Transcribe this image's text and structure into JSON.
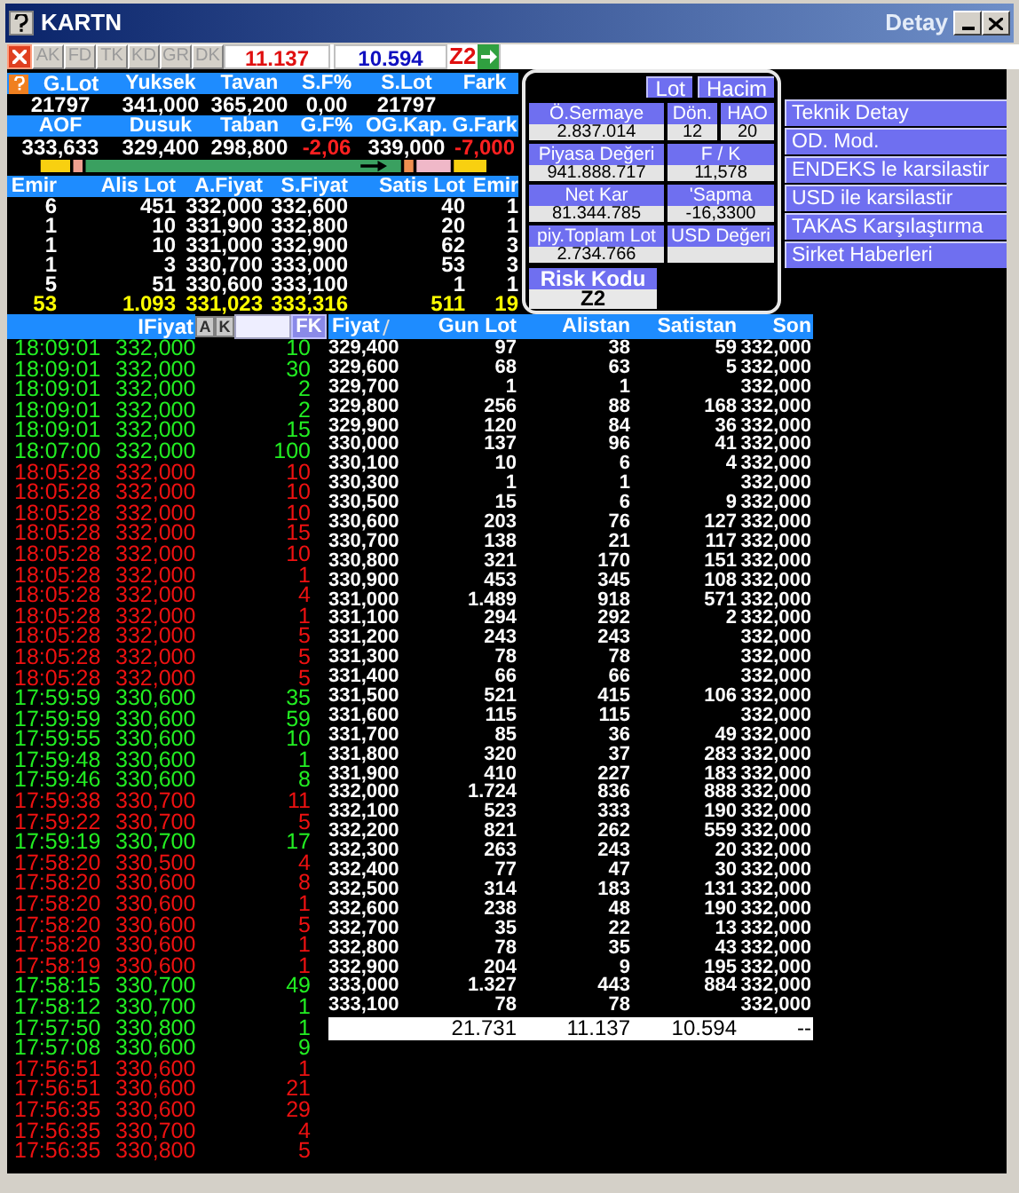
{
  "window": {
    "title": "KARTN",
    "detail_title": "Detay"
  },
  "toolbar": {
    "tabs": [
      {
        "label": "AK",
        "disabled": true
      },
      {
        "label": "FD",
        "disabled": true
      },
      {
        "label": "TK",
        "disabled": true
      },
      {
        "label": "KD",
        "disabled": true
      },
      {
        "label": "GR",
        "disabled": true
      },
      {
        "label": "DK",
        "disabled": true
      }
    ],
    "buy_total": "11.137",
    "sell_total": "10.594",
    "risk_code": "Z2"
  },
  "summary": [
    {
      "kind": "header",
      "cells": [
        {
          "text": "G.Lot"
        },
        {
          "text": "Yuksek"
        },
        {
          "text": "Tavan"
        },
        {
          "text": "S.F%"
        },
        {
          "text": "S.Lot"
        },
        {
          "text": "Fark"
        }
      ]
    },
    {
      "kind": "values",
      "cells": [
        {
          "text": "21797"
        },
        {
          "text": "341,000"
        },
        {
          "text": "365,200"
        },
        {
          "text": "0,00"
        },
        {
          "text": "21797"
        }
      ]
    },
    {
      "kind": "header",
      "cells": [
        {
          "text": "AOF"
        },
        {
          "text": "Dusuk"
        },
        {
          "text": "Taban"
        },
        {
          "text": "G.F%"
        },
        {
          "text": "OG.Kap."
        },
        {
          "text": "G.Fark"
        }
      ]
    },
    {
      "kind": "values",
      "cells": [
        {
          "text": "333,633"
        },
        {
          "text": "329,400"
        },
        {
          "text": "298,800"
        },
        {
          "text": "-2,06",
          "color": "#ff2020"
        },
        {
          "text": "339,000"
        },
        {
          "text": "-7,000",
          "color": "#ff2020"
        }
      ]
    }
  ],
  "depth": {
    "columns": [
      "Emir",
      "Alis Lot",
      "A.Fiyat",
      "S.Fiyat",
      "Satis Lot",
      "Emir"
    ],
    "rows": [
      [
        "6",
        "451",
        "332,000",
        "332,600",
        "40",
        "1"
      ],
      [
        "1",
        "10",
        "331,900",
        "332,800",
        "20",
        "1"
      ],
      [
        "1",
        "10",
        "331,000",
        "332,900",
        "62",
        "3"
      ],
      [
        "1",
        "3",
        "330,700",
        "333,000",
        "53",
        "3"
      ],
      [
        "5",
        "51",
        "330,600",
        "333,100",
        "1",
        "1"
      ]
    ],
    "total": [
      "53",
      "1.093",
      "331,023",
      "333,316",
      "511",
      "19"
    ]
  },
  "fundamentals": {
    "buttons": [
      {
        "label": "Lot"
      },
      {
        "label": "Hacim"
      }
    ],
    "fields": [
      {
        "label": "Ö.Sermaye",
        "value": "2.837.014"
      },
      {
        "label": "Dön.",
        "value": "12"
      },
      {
        "label": "HAO",
        "value": "20"
      },
      {
        "label": "Piyasa Değeri",
        "value": "941.888.717"
      },
      {
        "label": "F / K",
        "value": "11,578"
      },
      {
        "label": "Net Kar",
        "value": "81.344.785"
      },
      {
        "label": "'Sapma",
        "value": "-16,3300"
      },
      {
        "label": "piy.Toplam Lot",
        "value": "2.734.766"
      },
      {
        "label": "USD Değeri"
      }
    ],
    "risk": {
      "label": "Risk Kodu",
      "value": "Z2"
    }
  },
  "menu": [
    {
      "label": "Teknik Detay"
    },
    {
      "label": "OD. Mod."
    },
    {
      "label": "ENDEKS le karsilastir"
    },
    {
      "label": "USD ile karsilastir"
    },
    {
      "label": "TAKAS Karşılaştırma"
    },
    {
      "label": "Sirket Haberleri"
    }
  ],
  "trades": {
    "header": "IFiyat",
    "buttons": [
      "A",
      "K"
    ],
    "filter_button": "FK",
    "rows": [
      {
        "time": "18:09:01",
        "price": "332,000",
        "lot": "10",
        "color": "#22ee22"
      },
      {
        "time": "18:09:01",
        "price": "332,000",
        "lot": "30",
        "color": "#22ee22"
      },
      {
        "time": "18:09:01",
        "price": "332,000",
        "lot": "2",
        "color": "#22ee22"
      },
      {
        "time": "18:09:01",
        "price": "332,000",
        "lot": "2",
        "color": "#22ee22"
      },
      {
        "time": "18:09:01",
        "price": "332,000",
        "lot": "15",
        "color": "#22ee22"
      },
      {
        "time": "18:07:00",
        "price": "332,000",
        "lot": "100",
        "color": "#22ee22"
      },
      {
        "time": "18:05:28",
        "price": "332,000",
        "lot": "10",
        "color": "#ee1111"
      },
      {
        "time": "18:05:28",
        "price": "332,000",
        "lot": "10",
        "color": "#ee1111"
      },
      {
        "time": "18:05:28",
        "price": "332,000",
        "lot": "10",
        "color": "#ee1111"
      },
      {
        "time": "18:05:28",
        "price": "332,000",
        "lot": "15",
        "color": "#ee1111"
      },
      {
        "time": "18:05:28",
        "price": "332,000",
        "lot": "10",
        "color": "#ee1111"
      },
      {
        "time": "18:05:28",
        "price": "332,000",
        "lot": "1",
        "color": "#ee1111"
      },
      {
        "time": "18:05:28",
        "price": "332,000",
        "lot": "4",
        "color": "#ee1111"
      },
      {
        "time": "18:05:28",
        "price": "332,000",
        "lot": "1",
        "color": "#ee1111"
      },
      {
        "time": "18:05:28",
        "price": "332,000",
        "lot": "5",
        "color": "#ee1111"
      },
      {
        "time": "18:05:28",
        "price": "332,000",
        "lot": "5",
        "color": "#ee1111"
      },
      {
        "time": "18:05:28",
        "price": "332,000",
        "lot": "5",
        "color": "#ee1111"
      },
      {
        "time": "17:59:59",
        "price": "330,600",
        "lot": "35",
        "color": "#22ee22"
      },
      {
        "time": "17:59:59",
        "price": "330,600",
        "lot": "59",
        "color": "#22ee22"
      },
      {
        "time": "17:59:55",
        "price": "330,600",
        "lot": "10",
        "color": "#22ee22"
      },
      {
        "time": "17:59:48",
        "price": "330,600",
        "lot": "1",
        "color": "#22ee22"
      },
      {
        "time": "17:59:46",
        "price": "330,600",
        "lot": "8",
        "color": "#22ee22"
      },
      {
        "time": "17:59:38",
        "price": "330,700",
        "lot": "11",
        "color": "#ee1111"
      },
      {
        "time": "17:59:22",
        "price": "330,700",
        "lot": "5",
        "color": "#ee1111"
      },
      {
        "time": "17:59:19",
        "price": "330,700",
        "lot": "17",
        "color": "#22ee22"
      },
      {
        "time": "17:58:20",
        "price": "330,500",
        "lot": "4",
        "color": "#ee1111"
      },
      {
        "time": "17:58:20",
        "price": "330,600",
        "lot": "8",
        "color": "#ee1111"
      },
      {
        "time": "17:58:20",
        "price": "330,600",
        "lot": "1",
        "color": "#ee1111"
      },
      {
        "time": "17:58:20",
        "price": "330,600",
        "lot": "5",
        "color": "#ee1111"
      },
      {
        "time": "17:58:20",
        "price": "330,600",
        "lot": "1",
        "color": "#ee1111"
      },
      {
        "time": "17:58:19",
        "price": "330,600",
        "lot": "1",
        "color": "#ee1111"
      },
      {
        "time": "17:58:15",
        "price": "330,700",
        "lot": "49",
        "color": "#22ee22"
      },
      {
        "time": "17:58:12",
        "price": "330,700",
        "lot": "1",
        "color": "#22ee22"
      },
      {
        "time": "17:57:50",
        "price": "330,800",
        "lot": "1",
        "color": "#22ee22"
      },
      {
        "time": "17:57:08",
        "price": "330,600",
        "lot": "9",
        "color": "#22ee22"
      },
      {
        "time": "17:56:51",
        "price": "330,600",
        "lot": "1",
        "color": "#ee1111"
      },
      {
        "time": "17:56:51",
        "price": "330,600",
        "lot": "21",
        "color": "#ee1111"
      },
      {
        "time": "17:56:35",
        "price": "330,600",
        "lot": "29",
        "color": "#ee1111"
      },
      {
        "time": "17:56:35",
        "price": "330,700",
        "lot": "4",
        "color": "#ee1111"
      },
      {
        "time": "17:56:35",
        "price": "330,800",
        "lot": "5",
        "color": "#ee1111"
      }
    ]
  },
  "price_table": {
    "columns": [
      "Fiyat",
      "Gun Lot",
      "Alistan",
      "Satistan",
      "Son"
    ],
    "rows": [
      {
        "fiyat": "329,400",
        "gun_lot": "97",
        "alistan": "38",
        "satistan": "59",
        "son": "332,000"
      },
      {
        "fiyat": "329,600",
        "gun_lot": "68",
        "alistan": "63",
        "satistan": "5",
        "son": "332,000"
      },
      {
        "fiyat": "329,700",
        "gun_lot": "1",
        "alistan": "1",
        "son": "332,000"
      },
      {
        "fiyat": "329,800",
        "gun_lot": "256",
        "alistan": "88",
        "satistan": "168",
        "son": "332,000"
      },
      {
        "fiyat": "329,900",
        "gun_lot": "120",
        "alistan": "84",
        "satistan": "36",
        "son": "332,000"
      },
      {
        "fiyat": "330,000",
        "gun_lot": "137",
        "alistan": "96",
        "satistan": "41",
        "son": "332,000"
      },
      {
        "fiyat": "330,100",
        "gun_lot": "10",
        "alistan": "6",
        "satistan": "4",
        "son": "332,000"
      },
      {
        "fiyat": "330,300",
        "gun_lot": "1",
        "alistan": "1",
        "son": "332,000"
      },
      {
        "fiyat": "330,500",
        "gun_lot": "15",
        "alistan": "6",
        "satistan": "9",
        "son": "332,000"
      },
      {
        "fiyat": "330,600",
        "gun_lot": "203",
        "alistan": "76",
        "satistan": "127",
        "son": "332,000"
      },
      {
        "fiyat": "330,700",
        "gun_lot": "138",
        "alistan": "21",
        "satistan": "117",
        "son": "332,000"
      },
      {
        "fiyat": "330,800",
        "gun_lot": "321",
        "alistan": "170",
        "satistan": "151",
        "son": "332,000"
      },
      {
        "fiyat": "330,900",
        "gun_lot": "453",
        "alistan": "345",
        "satistan": "108",
        "son": "332,000"
      },
      {
        "fiyat": "331,000",
        "gun_lot": "1.489",
        "alistan": "918",
        "satistan": "571",
        "son": "332,000"
      },
      {
        "fiyat": "331,100",
        "gun_lot": "294",
        "alistan": "292",
        "satistan": "2",
        "son": "332,000"
      },
      {
        "fiyat": "331,200",
        "gun_lot": "243",
        "alistan": "243",
        "son": "332,000"
      },
      {
        "fiyat": "331,300",
        "gun_lot": "78",
        "alistan": "78",
        "son": "332,000"
      },
      {
        "fiyat": "331,400",
        "gun_lot": "66",
        "alistan": "66",
        "son": "332,000"
      },
      {
        "fiyat": "331,500",
        "gun_lot": "521",
        "alistan": "415",
        "satistan": "106",
        "son": "332,000"
      },
      {
        "fiyat": "331,600",
        "gun_lot": "115",
        "alistan": "115",
        "son": "332,000"
      },
      {
        "fiyat": "331,700",
        "gun_lot": "85",
        "alistan": "36",
        "satistan": "49",
        "son": "332,000"
      },
      {
        "fiyat": "331,800",
        "gun_lot": "320",
        "alistan": "37",
        "satistan": "283",
        "son": "332,000"
      },
      {
        "fiyat": "331,900",
        "gun_lot": "410",
        "alistan": "227",
        "satistan": "183",
        "son": "332,000"
      },
      {
        "fiyat": "332,000",
        "gun_lot": "1.724",
        "alistan": "836",
        "satistan": "888",
        "son": "332,000"
      },
      {
        "fiyat": "332,100",
        "gun_lot": "523",
        "alistan": "333",
        "satistan": "190",
        "son": "332,000"
      },
      {
        "fiyat": "332,200",
        "gun_lot": "821",
        "alistan": "262",
        "satistan": "559",
        "son": "332,000"
      },
      {
        "fiyat": "332,300",
        "gun_lot": "263",
        "alistan": "243",
        "satistan": "20",
        "son": "332,000"
      },
      {
        "fiyat": "332,400",
        "gun_lot": "77",
        "alistan": "47",
        "satistan": "30",
        "son": "332,000"
      },
      {
        "fiyat": "332,500",
        "gun_lot": "314",
        "alistan": "183",
        "satistan": "131",
        "son": "332,000"
      },
      {
        "fiyat": "332,600",
        "gun_lot": "238",
        "alistan": "48",
        "satistan": "190",
        "son": "332,000"
      },
      {
        "fiyat": "332,700",
        "gun_lot": "35",
        "alistan": "22",
        "satistan": "13",
        "son": "332,000"
      },
      {
        "fiyat": "332,800",
        "gun_lot": "78",
        "alistan": "35",
        "satistan": "43",
        "son": "332,000"
      },
      {
        "fiyat": "332,900",
        "gun_lot": "204",
        "alistan": "9",
        "satistan": "195",
        "son": "332,000"
      },
      {
        "fiyat": "333,000",
        "gun_lot": "1.327",
        "alistan": "443",
        "satistan": "884",
        "son": "332,000"
      },
      {
        "fiyat": "333,100",
        "gun_lot": "78",
        "alistan": "78",
        "son": "332,000"
      }
    ],
    "total": {
      "gun_lot": "21.731",
      "alistan": "11.137",
      "satistan": "10.594",
      "son": "--"
    }
  }
}
